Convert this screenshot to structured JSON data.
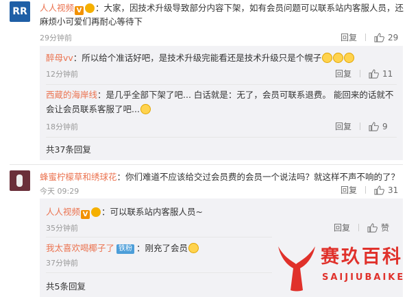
{
  "comments": [
    {
      "user": "人人视频",
      "text_line1": "：大家，因技术升级导致部分内容下架，如有会员问题可以联系站内客服人员，还",
      "text_line2": "麻烦小可爱们再耐心等待下",
      "time": "29分钟前",
      "reply_label": "回复",
      "likes": "29",
      "replies": [
        {
          "user": "醉母vv",
          "text": "：所以给个准话好吧，是技术升级完能看还是技术升级只是个幌子",
          "time": "12分钟前",
          "reply_label": "回复",
          "likes": "11"
        },
        {
          "user": "西蔵的海岸线",
          "text_line1": "：是几乎全部下架了吧... 白话就是：无了，会员可联系退费。 能回来的话就不",
          "text_line2": "会让会员联系客服了吧...",
          "time": "18分钟前",
          "reply_label": "回复",
          "likes": "9"
        }
      ],
      "more": "共37条回复"
    },
    {
      "user": "蜂蜜柠檬草和绣球花",
      "text": "：你们难道不应该给交过会员费的会员一个说法吗？就这样不声不响的了？",
      "time": "今天 09:29",
      "reply_label": "回复",
      "likes": "31",
      "replies": [
        {
          "user": "人人视频",
          "text": "：可以联系站内客服人员~",
          "time": "35分钟前",
          "reply_label": "回复",
          "likes": "赞"
        },
        {
          "user": "我太喜欢喝椰子了",
          "tag": "铁粉",
          "text": "：刚充了会员",
          "time": "37分钟前",
          "reply_label": "回复"
        }
      ],
      "more": "共5条回复"
    }
  ],
  "watermark": {
    "brand": "赛玖百科",
    "sub": "SAIJIUBAIKE"
  },
  "colors": {
    "username": "#eb7350",
    "reply_bg": "#f2f2f5",
    "watermark_red": "#e0312b"
  }
}
